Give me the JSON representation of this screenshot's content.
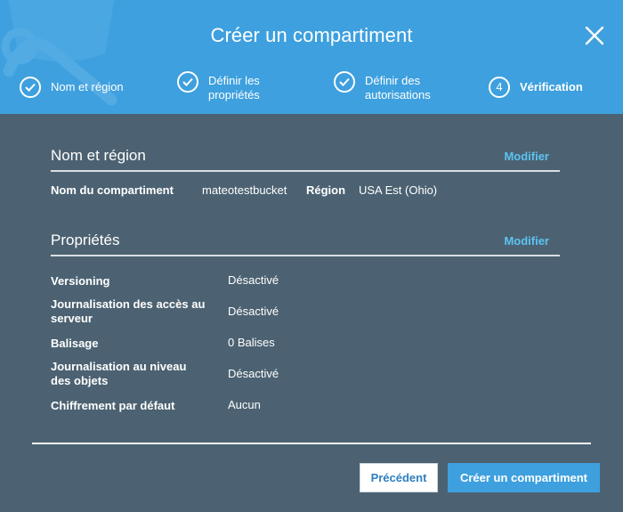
{
  "dialog": {
    "title": "Créer un compartiment"
  },
  "steps": [
    {
      "label_line1": "Nom et région",
      "label_line2": "",
      "state": "done"
    },
    {
      "label_line1": "Définir les",
      "label_line2": "propriétés",
      "state": "done"
    },
    {
      "label_line1": "Définir des",
      "label_line2": "autorisations",
      "state": "done"
    },
    {
      "number": "4",
      "label_line1": "Vérification",
      "label_line2": "",
      "state": "current"
    }
  ],
  "sections": {
    "name_region": {
      "title": "Nom et région",
      "edit_label": "Modifier",
      "bucket_name_key": "Nom du compartiment",
      "bucket_name_value": "mateotestbucket",
      "region_key": "Région",
      "region_value": "USA Est (Ohio)"
    },
    "properties": {
      "title": "Propriétés",
      "edit_label": "Modifier",
      "rows": [
        {
          "key_line1": "Versioning",
          "key_line2": "",
          "value": "Désactivé"
        },
        {
          "key_line1": "Journalisation des accès au",
          "key_line2": "serveur",
          "value": "Désactivé"
        },
        {
          "key_line1": "Balisage",
          "key_line2": "",
          "value": "0 Balises"
        },
        {
          "key_line1": "Journalisation au niveau",
          "key_line2": "des objets",
          "value": "Désactivé"
        },
        {
          "key_line1": "Chiffrement par défaut",
          "key_line2": "",
          "value": "Aucun"
        }
      ]
    }
  },
  "buttons": {
    "previous": "Précédent",
    "create": "Créer un compartiment"
  },
  "colors": {
    "header_bg": "#3ea0de",
    "body_bg": "#4c6272",
    "link": "#5cc3f2",
    "primary_button": "#3ea0de"
  }
}
